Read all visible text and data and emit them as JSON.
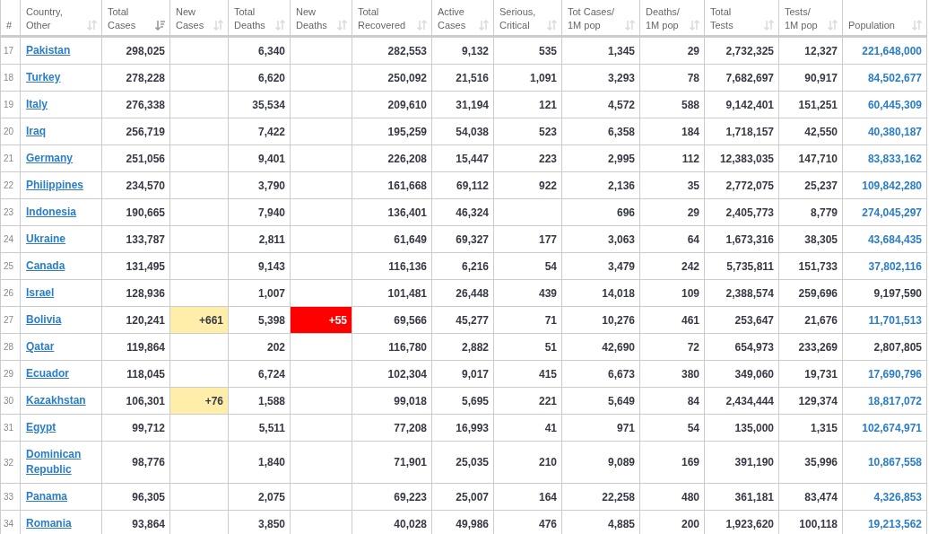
{
  "table": {
    "columns": [
      {
        "label": "#"
      },
      {
        "label": "Country,\nOther",
        "sorted": false
      },
      {
        "label": "Total\nCases",
        "sorted": true
      },
      {
        "label": "New\nCases",
        "sorted": false
      },
      {
        "label": "Total\nDeaths",
        "sorted": false
      },
      {
        "label": "New\nDeaths",
        "sorted": false
      },
      {
        "label": "Total\nRecovered",
        "sorted": false
      },
      {
        "label": "Active\nCases",
        "sorted": false
      },
      {
        "label": "Serious,\nCritical",
        "sorted": false
      },
      {
        "label": "Tot Cases/\n1M pop",
        "sorted": false
      },
      {
        "label": "Deaths/\n1M pop",
        "sorted": false
      },
      {
        "label": "Total\nTests",
        "sorted": false
      },
      {
        "label": "Tests/\n1M pop",
        "sorted": false
      },
      {
        "label": "Population",
        "sorted": false
      }
    ],
    "rows": [
      {
        "rank": "17",
        "country": "Pakistan",
        "total_cases": "298,025",
        "total_deaths": "6,340",
        "total_recovered": "282,553",
        "active_cases": "9,132",
        "serious_critical": "535",
        "cases_per_1m": "1,345",
        "deaths_per_1m": "29",
        "total_tests": "2,732,325",
        "tests_per_1m": "12,327",
        "population": "221,648,000",
        "population_linked": true
      },
      {
        "rank": "18",
        "country": "Turkey",
        "total_cases": "278,228",
        "total_deaths": "6,620",
        "total_recovered": "250,092",
        "active_cases": "21,516",
        "serious_critical": "1,091",
        "cases_per_1m": "3,293",
        "deaths_per_1m": "78",
        "total_tests": "7,682,697",
        "tests_per_1m": "90,917",
        "population": "84,502,677",
        "population_linked": true
      },
      {
        "rank": "19",
        "country": "Italy",
        "total_cases": "276,338",
        "total_deaths": "35,534",
        "total_recovered": "209,610",
        "active_cases": "31,194",
        "serious_critical": "121",
        "cases_per_1m": "4,572",
        "deaths_per_1m": "588",
        "total_tests": "9,142,401",
        "tests_per_1m": "151,251",
        "population": "60,445,309",
        "population_linked": true
      },
      {
        "rank": "20",
        "country": "Iraq",
        "total_cases": "256,719",
        "total_deaths": "7,422",
        "total_recovered": "195,259",
        "active_cases": "54,038",
        "serious_critical": "523",
        "cases_per_1m": "6,358",
        "deaths_per_1m": "184",
        "total_tests": "1,718,157",
        "tests_per_1m": "42,550",
        "population": "40,380,187",
        "population_linked": true
      },
      {
        "rank": "21",
        "country": "Germany",
        "total_cases": "251,056",
        "total_deaths": "9,401",
        "total_recovered": "226,208",
        "active_cases": "15,447",
        "serious_critical": "223",
        "cases_per_1m": "2,995",
        "deaths_per_1m": "112",
        "total_tests": "12,383,035",
        "tests_per_1m": "147,710",
        "population": "83,833,162",
        "population_linked": true
      },
      {
        "rank": "22",
        "country": "Philippines",
        "total_cases": "234,570",
        "total_deaths": "3,790",
        "total_recovered": "161,668",
        "active_cases": "69,112",
        "serious_critical": "922",
        "cases_per_1m": "2,136",
        "deaths_per_1m": "35",
        "total_tests": "2,772,075",
        "tests_per_1m": "25,237",
        "population": "109,842,280",
        "population_linked": true
      },
      {
        "rank": "23",
        "country": "Indonesia",
        "total_cases": "190,665",
        "total_deaths": "7,940",
        "total_recovered": "136,401",
        "active_cases": "46,324",
        "cases_per_1m": "696",
        "deaths_per_1m": "29",
        "total_tests": "2,405,773",
        "tests_per_1m": "8,779",
        "population": "274,045,297",
        "population_linked": true
      },
      {
        "rank": "24",
        "country": "Ukraine",
        "total_cases": "133,787",
        "total_deaths": "2,811",
        "total_recovered": "61,649",
        "active_cases": "69,327",
        "serious_critical": "177",
        "cases_per_1m": "3,063",
        "deaths_per_1m": "64",
        "total_tests": "1,673,316",
        "tests_per_1m": "38,305",
        "population": "43,684,435",
        "population_linked": true
      },
      {
        "rank": "25",
        "country": "Canada",
        "total_cases": "131,495",
        "total_deaths": "9,143",
        "total_recovered": "116,136",
        "active_cases": "6,216",
        "serious_critical": "54",
        "cases_per_1m": "3,479",
        "deaths_per_1m": "242",
        "total_tests": "5,735,811",
        "tests_per_1m": "151,733",
        "population": "37,802,116",
        "population_linked": true
      },
      {
        "rank": "26",
        "country": "Israel",
        "total_cases": "128,936",
        "total_deaths": "1,007",
        "total_recovered": "101,481",
        "active_cases": "26,448",
        "serious_critical": "439",
        "cases_per_1m": "14,018",
        "deaths_per_1m": "109",
        "total_tests": "2,388,574",
        "tests_per_1m": "259,696",
        "population": "9,197,590",
        "population_linked": false
      },
      {
        "rank": "27",
        "country": "Bolivia",
        "total_cases": "120,241",
        "new_cases": "+661",
        "total_deaths": "5,398",
        "new_deaths": "+55",
        "total_recovered": "69,566",
        "active_cases": "45,277",
        "serious_critical": "71",
        "cases_per_1m": "10,276",
        "deaths_per_1m": "461",
        "total_tests": "253,647",
        "tests_per_1m": "21,676",
        "population": "11,701,513",
        "population_linked": true
      },
      {
        "rank": "28",
        "country": "Qatar",
        "total_cases": "119,864",
        "total_deaths": "202",
        "total_recovered": "116,780",
        "active_cases": "2,882",
        "serious_critical": "51",
        "cases_per_1m": "42,690",
        "deaths_per_1m": "72",
        "total_tests": "654,973",
        "tests_per_1m": "233,269",
        "population": "2,807,805",
        "population_linked": false
      },
      {
        "rank": "29",
        "country": "Ecuador",
        "total_cases": "118,045",
        "total_deaths": "6,724",
        "total_recovered": "102,304",
        "active_cases": "9,017",
        "serious_critical": "415",
        "cases_per_1m": "6,673",
        "deaths_per_1m": "380",
        "total_tests": "349,060",
        "tests_per_1m": "19,731",
        "population": "17,690,796",
        "population_linked": true
      },
      {
        "rank": "30",
        "country": "Kazakhstan",
        "total_cases": "106,301",
        "new_cases": "+76",
        "total_deaths": "1,588",
        "total_recovered": "99,018",
        "active_cases": "5,695",
        "serious_critical": "221",
        "cases_per_1m": "5,649",
        "deaths_per_1m": "84",
        "total_tests": "2,434,444",
        "tests_per_1m": "129,374",
        "population": "18,817,072",
        "population_linked": true
      },
      {
        "rank": "31",
        "country": "Egypt",
        "total_cases": "99,712",
        "total_deaths": "5,511",
        "total_recovered": "77,208",
        "active_cases": "16,993",
        "serious_critical": "41",
        "cases_per_1m": "971",
        "deaths_per_1m": "54",
        "total_tests": "135,000",
        "tests_per_1m": "1,315",
        "population": "102,674,971",
        "population_linked": true
      },
      {
        "rank": "32",
        "country": "Dominican Republic",
        "total_cases": "98,776",
        "total_deaths": "1,840",
        "total_recovered": "71,901",
        "active_cases": "25,035",
        "serious_critical": "210",
        "cases_per_1m": "9,089",
        "deaths_per_1m": "169",
        "total_tests": "391,190",
        "tests_per_1m": "35,996",
        "population": "10,867,558",
        "population_linked": true
      },
      {
        "rank": "33",
        "country": "Panama",
        "total_cases": "96,305",
        "total_deaths": "2,075",
        "total_recovered": "69,223",
        "active_cases": "25,007",
        "serious_critical": "164",
        "cases_per_1m": "22,258",
        "deaths_per_1m": "480",
        "total_tests": "361,181",
        "tests_per_1m": "83,474",
        "population": "4,326,853",
        "population_linked": true
      },
      {
        "rank": "34",
        "country": "Romania",
        "total_cases": "93,864",
        "total_deaths": "3,850",
        "total_recovered": "40,028",
        "active_cases": "49,986",
        "serious_critical": "476",
        "cases_per_1m": "4,885",
        "deaths_per_1m": "200",
        "total_tests": "1,923,620",
        "tests_per_1m": "100,118",
        "population": "19,213,562",
        "population_linked": true
      }
    ]
  }
}
